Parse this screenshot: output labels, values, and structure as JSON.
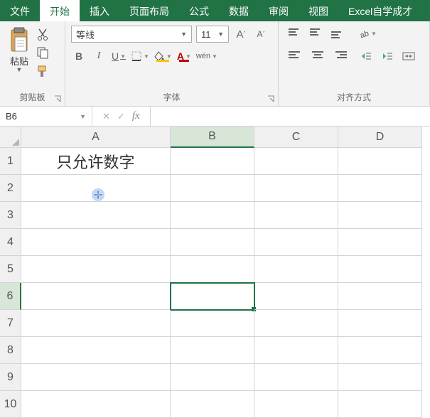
{
  "tabs": {
    "file": "文件",
    "home": "开始",
    "insert": "插入",
    "layout": "页面布局",
    "formula": "公式",
    "data": "数据",
    "review": "审阅",
    "view": "视图",
    "custom": "Excel自学成才"
  },
  "ribbon": {
    "clipboard": {
      "paste": "粘贴",
      "label": "剪贴板"
    },
    "font": {
      "name": "等线",
      "size": "11",
      "bold": "B",
      "italic": "I",
      "underline": "U",
      "increase": "A",
      "decrease": "A",
      "wen": "wén",
      "label": "字体"
    },
    "align": {
      "label": "对齐方式"
    }
  },
  "namebox": "B6",
  "fx": "fx",
  "columns": [
    "A",
    "B",
    "C",
    "D"
  ],
  "rows": [
    "1",
    "2",
    "3",
    "4",
    "5",
    "6",
    "7",
    "8",
    "9",
    "10"
  ],
  "cells": {
    "A1": "只允许数字"
  },
  "selected": {
    "col": "B",
    "row": "6"
  },
  "colors": {
    "accent": "#217346",
    "yellow": "#ffc000",
    "red": "#c00000"
  }
}
